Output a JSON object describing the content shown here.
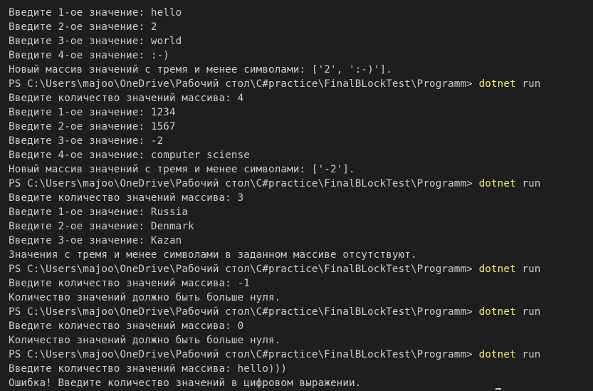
{
  "terminal": {
    "colors": {
      "background": "#1e1e1e",
      "foreground": "#cccccc",
      "command_highlight": "#f1f16a"
    },
    "lines": [
      {
        "text": "Введите 1-ое значение: hello"
      },
      {
        "text": "Введите 2-ое значение: 2"
      },
      {
        "text": "Введите 3-ое значение: world"
      },
      {
        "text": "Введите 4-ое значение: :-)"
      },
      {
        "text": "Новый массив значений с тремя и менее символами: ['2', ':-)']."
      },
      {
        "prompt": "PS C:\\Users\\majoo\\OneDrive\\Рабочий стол\\C#practice\\FinalBLockTest\\Programm> ",
        "command": "dotnet",
        "args": " run"
      },
      {
        "text": "Введите количество значений массива: 4"
      },
      {
        "text": "Введите 1-ое значение: 1234"
      },
      {
        "text": "Введите 2-ое значение: 1567"
      },
      {
        "text": "Введите 3-ое значение: -2"
      },
      {
        "text": "Введите 4-ое значение: computer sciense"
      },
      {
        "text": "Новый массив значений с тремя и менее символами: ['-2']."
      },
      {
        "prompt": "PS C:\\Users\\majoo\\OneDrive\\Рабочий стол\\C#practice\\FinalBLockTest\\Programm> ",
        "command": "dotnet",
        "args": " run"
      },
      {
        "text": "Введите количество значений массива: 3"
      },
      {
        "text": "Введите 1-ое значение: Russia"
      },
      {
        "text": "Введите 2-ое значение: Denmark"
      },
      {
        "text": "Введите 3-ое значение: Kazan"
      },
      {
        "text": "Значения с тремя и менее символами в заданном массиве отсутствуют."
      },
      {
        "prompt": "PS C:\\Users\\majoo\\OneDrive\\Рабочий стол\\C#practice\\FinalBLockTest\\Programm> ",
        "command": "dotnet",
        "args": " run"
      },
      {
        "text": "Введите количество значений массива: -1"
      },
      {
        "text": "Количество значений должно быть больше нуля."
      },
      {
        "prompt": "PS C:\\Users\\majoo\\OneDrive\\Рабочий стол\\C#practice\\FinalBLockTest\\Programm> ",
        "command": "dotnet",
        "args": " run"
      },
      {
        "text": "Введите количество значений массива: 0"
      },
      {
        "text": "Количество значений должно быть больше нуля."
      },
      {
        "prompt": "PS C:\\Users\\majoo\\OneDrive\\Рабочий стол\\C#practice\\FinalBLockTest\\Programm> ",
        "command": "dotnet",
        "args": " run"
      },
      {
        "text": "Введите количество значений массива: hello)))"
      },
      {
        "text": "Ошибка! Введите количество значений в цифровом выражении."
      }
    ]
  }
}
